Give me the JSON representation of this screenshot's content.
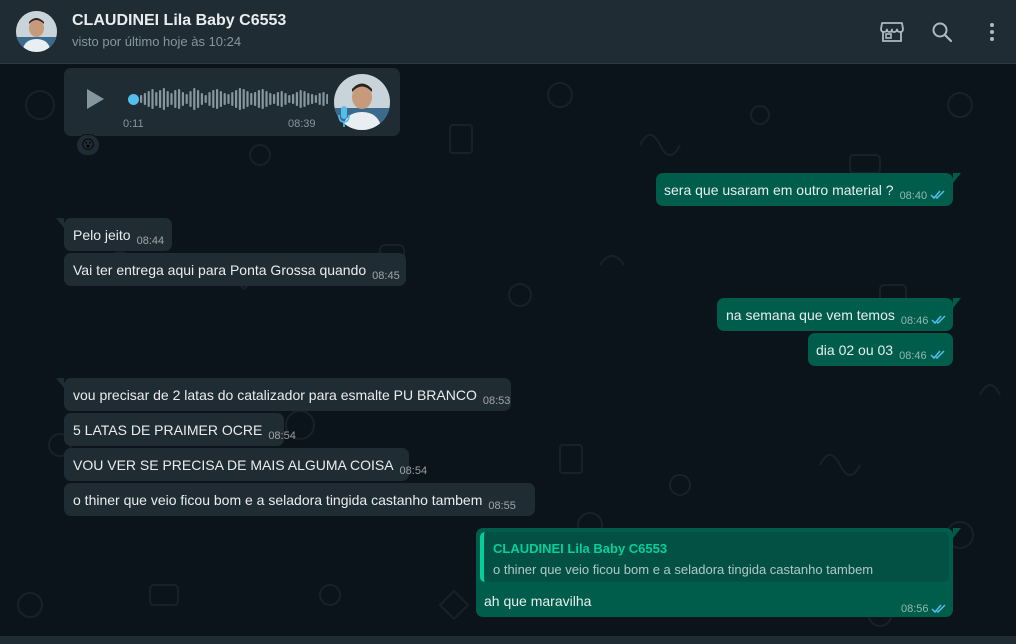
{
  "header": {
    "name": "CLAUDINEI Lila Baby C6553",
    "status": "visto por último hoje às 10:24",
    "icons": [
      "store-icon",
      "search-icon",
      "menu-icon"
    ]
  },
  "colors": {
    "incoming_bubble": "#202c33",
    "outgoing_bubble": "#005c4b",
    "read_ticks": "#53bdeb",
    "quote_accent": "#06cf9c"
  },
  "voice_message": {
    "elapsed": "0:11",
    "time": "08:39",
    "progress": 0.05,
    "reaction": "😮"
  },
  "messages": [
    {
      "text": "sera que usaram em outro material ?",
      "time": "08:40",
      "dir": "out"
    },
    {
      "text": "Pelo jeito",
      "time": "08:44",
      "dir": "in"
    },
    {
      "text": "Vai ter entrega aqui para Ponta Grossa quando",
      "time": "08:45",
      "dir": "in"
    },
    {
      "text": "na semana que vem temos",
      "time": "08:46",
      "dir": "out"
    },
    {
      "text": "dia 02 ou 03",
      "time": "08:46",
      "dir": "out"
    },
    {
      "text": "vou precisar de 2 latas do catalizador para esmalte PU BRANCO",
      "time": "08:53",
      "dir": "in"
    },
    {
      "text": "5 LATAS DE PRAIMER OCRE",
      "time": "08:54",
      "dir": "in"
    },
    {
      "text": "VOU VER SE PRECISA DE MAIS ALGUMA COISA",
      "time": "08:54",
      "dir": "in"
    },
    {
      "text": "o thiner que veio ficou bom  e a seladora tingida castanho tambem",
      "time": "08:55",
      "dir": "in"
    }
  ],
  "reply": {
    "quoted_name": "CLAUDINEI Lila Baby C6553",
    "quoted_text": "o thiner que veio ficou bom  e a seladora tingida castanho tambem",
    "text": "ah que maravilha",
    "time": "08:56"
  }
}
